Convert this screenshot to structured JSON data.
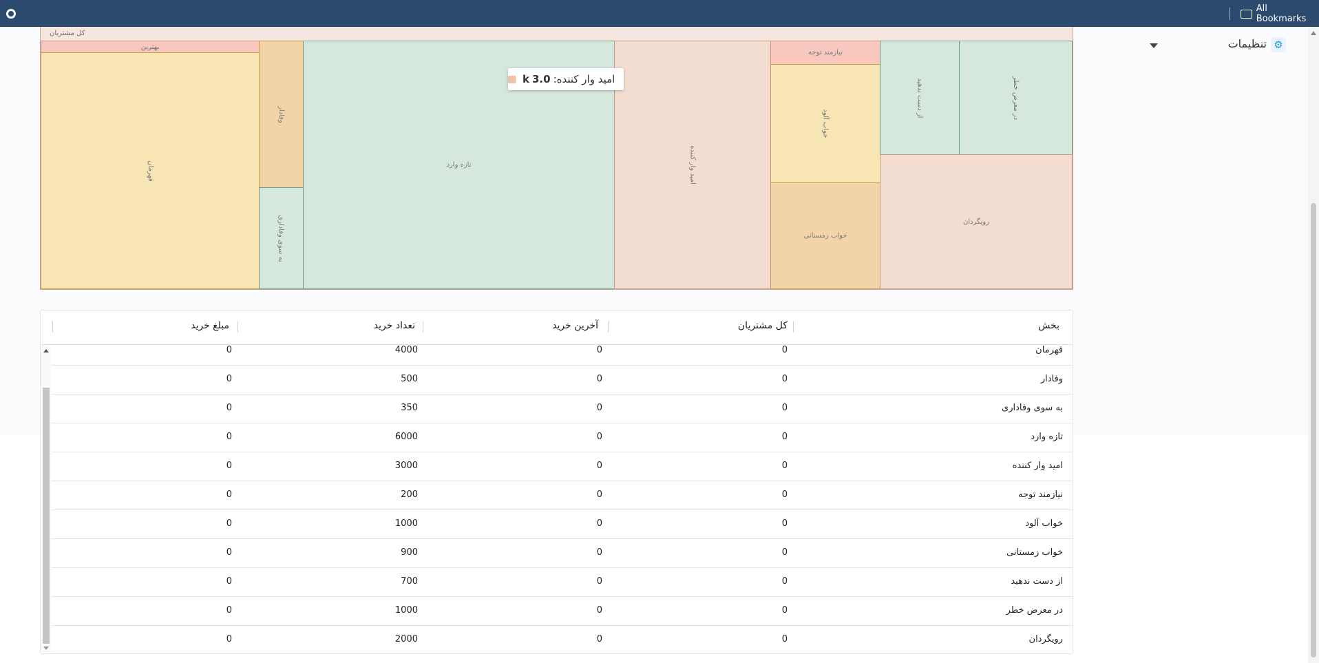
{
  "browser": {
    "bookmarks_label": "All Bookmarks"
  },
  "settings": {
    "label": "تنظیمات",
    "gear_icon": "⚙"
  },
  "treemap": {
    "root_label": "کل مشتریان",
    "tiles": {
      "best": "بهترین",
      "champion": "قهرمان",
      "loyal": "وفادار",
      "toward_loyal": "به سوی وفاداری",
      "newcomer": "تازه وارد",
      "hopeful": "امید وار کننده",
      "need_attention": "نیازمند توجه",
      "sleepy": "خواب آلود",
      "hibernate": "خواب زمستانی",
      "dont_lose": "از دست ندهید",
      "at_risk": "در معرض خطر",
      "churned": "رویگردان"
    },
    "tooltip": {
      "label": "امید وار کننده:",
      "value": "3.0",
      "suffix": "k",
      "swatch_color": "#f3c1a8"
    }
  },
  "table": {
    "headers": {
      "segment": "بخش",
      "total_customers": "کل مشتریان",
      "last_purchase": "آخرین خرید",
      "purchase_count": "تعداد خرید",
      "purchase_amount": "مبلغ خرید"
    },
    "rows": [
      {
        "name": "قهرمان",
        "total": "0",
        "last": "0",
        "count": "4000",
        "amount": "0"
      },
      {
        "name": "وفادار",
        "total": "0",
        "last": "0",
        "count": "500",
        "amount": "0"
      },
      {
        "name": "به سوی وفاداری",
        "total": "0",
        "last": "0",
        "count": "350",
        "amount": "0"
      },
      {
        "name": "تازه وارد",
        "total": "0",
        "last": "0",
        "count": "6000",
        "amount": "0"
      },
      {
        "name": "امید وار کننده",
        "total": "0",
        "last": "0",
        "count": "3000",
        "amount": "0"
      },
      {
        "name": "نیازمند توجه",
        "total": "0",
        "last": "0",
        "count": "200",
        "amount": "0"
      },
      {
        "name": "خواب آلود",
        "total": "0",
        "last": "0",
        "count": "1000",
        "amount": "0"
      },
      {
        "name": "خواب زمستانی",
        "total": "0",
        "last": "0",
        "count": "900",
        "amount": "0"
      },
      {
        "name": "از دست ندهید",
        "total": "0",
        "last": "0",
        "count": "700",
        "amount": "0"
      },
      {
        "name": "در معرض خطر",
        "total": "0",
        "last": "0",
        "count": "1000",
        "amount": "0"
      },
      {
        "name": "رویگردان",
        "total": "0",
        "last": "0",
        "count": "2000",
        "amount": "0"
      }
    ]
  }
}
